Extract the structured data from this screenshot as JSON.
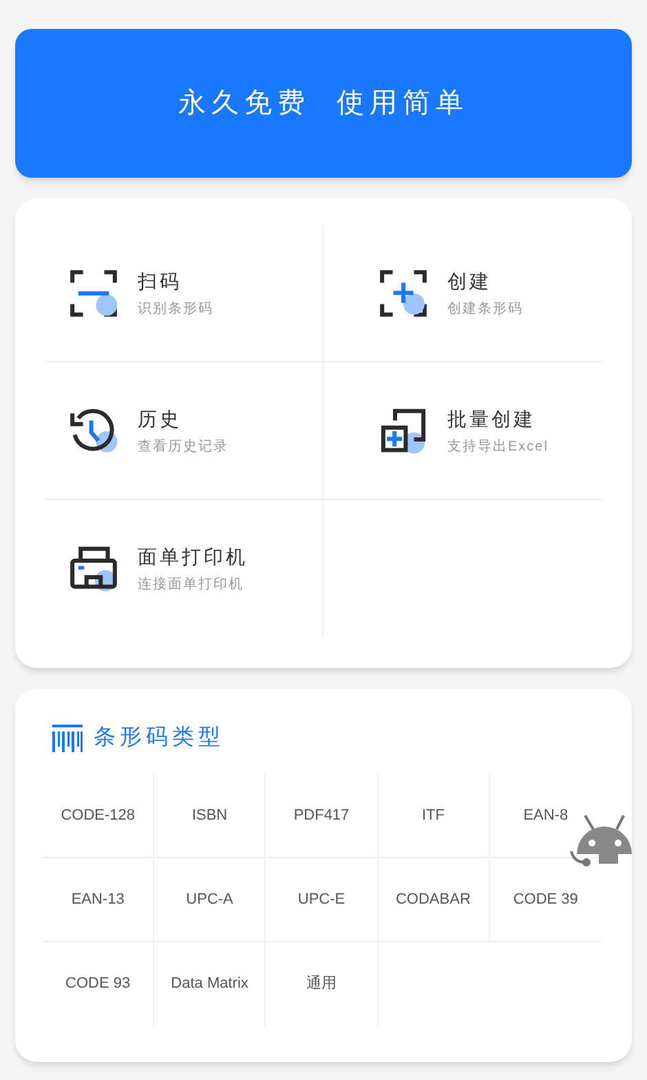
{
  "banner": {
    "text": "永久免费  使用简单"
  },
  "features": [
    {
      "kind": "scan",
      "title": "扫码",
      "subtitle": "识别条形码"
    },
    {
      "kind": "create",
      "title": "创建",
      "subtitle": "创建条形码"
    },
    {
      "kind": "history",
      "title": "历史",
      "subtitle": "查看历史记录"
    },
    {
      "kind": "batch",
      "title": "批量创建",
      "subtitle": "支持导出Excel"
    },
    {
      "kind": "printer",
      "title": "面单打印机",
      "subtitle": "连接面单打印机"
    }
  ],
  "barcode_types": {
    "title": "条形码类型",
    "items": [
      "CODE-128",
      "ISBN",
      "PDF417",
      "ITF",
      "EAN-8",
      "EAN-13",
      "UPC-A",
      "UPC-E",
      "CODABAR",
      "CODE 39",
      "CODE 93",
      "Data Matrix",
      "通用"
    ]
  }
}
